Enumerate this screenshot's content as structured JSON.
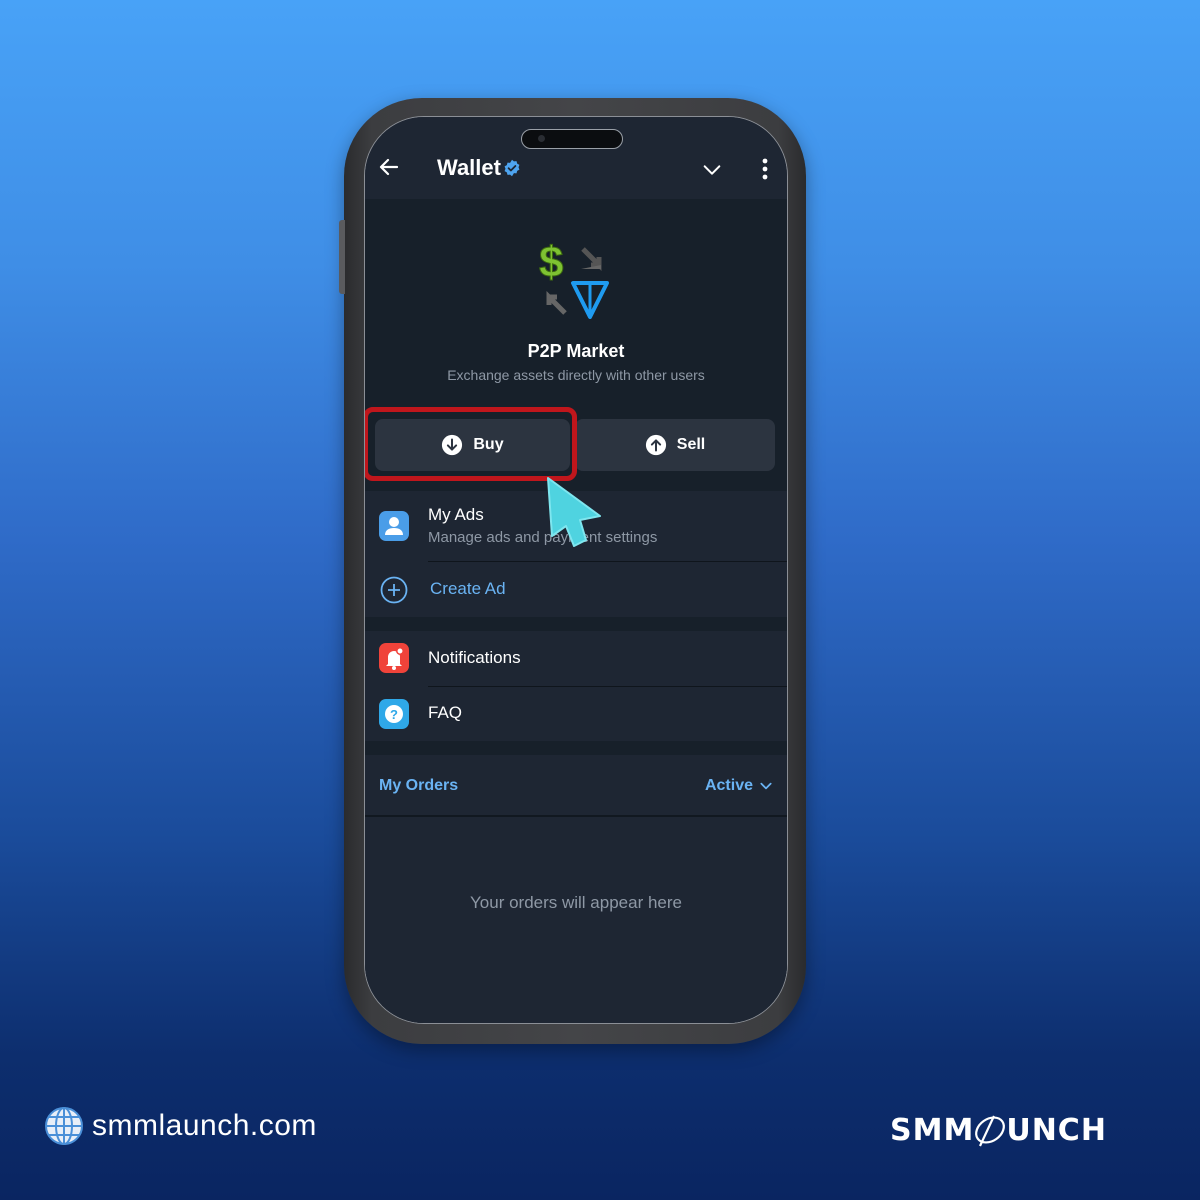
{
  "header": {
    "title": "Wallet",
    "verified": true,
    "icons": [
      "back-arrow-icon",
      "verified-badge-icon",
      "chevron-down-icon",
      "more-vertical-icon"
    ]
  },
  "hero": {
    "logo_icon": "p2p-exchange-icon",
    "title": "P2P Market",
    "subtitle": "Exchange assets directly with other users"
  },
  "actions": {
    "buy_label": "Buy",
    "sell_label": "Sell",
    "highlighted": "Buy"
  },
  "menu": {
    "my_ads": {
      "label": "My Ads",
      "sub": "Manage ads and payment settings"
    },
    "create_ad": {
      "label": "Create Ad"
    },
    "notifications": {
      "label": "Notifications"
    },
    "faq": {
      "label": "FAQ"
    }
  },
  "orders": {
    "title": "My Orders",
    "filter": "Active",
    "empty": "Your orders will appear here"
  },
  "footer": {
    "site": "smmlaunch.com",
    "brand": {
      "left": "SMM",
      "right": "UNCH"
    }
  },
  "colors": {
    "accent": "#6ab3f3",
    "highlight": "#c0161c",
    "cursor": "#4fd3e0",
    "notifications_icon": "#f0433a",
    "faq_icon": "#2fa8e8",
    "my_ads_icon": "#4a9de8"
  }
}
